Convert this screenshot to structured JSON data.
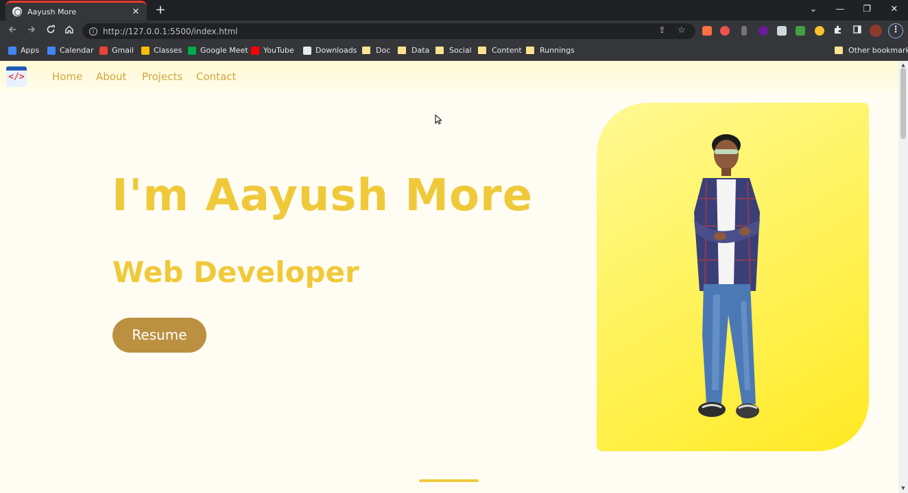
{
  "browser": {
    "tab": {
      "title": "Aayush More",
      "close_label": "✕"
    },
    "new_tab_label": "+",
    "window_controls": {
      "chevron": "⌄",
      "minimize": "—",
      "restore": "❐",
      "close": "✕"
    },
    "url": "http://127.0.0.1:5500/index.html",
    "bookmarks": [
      {
        "label": "Apps",
        "icon": "apps-grid-icon",
        "color": "#4285f4"
      },
      {
        "label": "Calendar",
        "icon": "calendar-icon",
        "color": "#4285f4"
      },
      {
        "label": "Gmail",
        "icon": "gmail-icon",
        "color": "#ea4335"
      },
      {
        "label": "Classes",
        "icon": "classroom-icon",
        "color": "#fbbc04"
      },
      {
        "label": "Google Meet",
        "icon": "meet-icon",
        "color": "#00ac47"
      },
      {
        "label": "YouTube",
        "icon": "youtube-icon",
        "color": "#ff0000"
      },
      {
        "label": "Downloads",
        "icon": "download-icon",
        "color": "#e8eaed"
      },
      {
        "label": "Doc",
        "icon": "folder-icon",
        "color": "#fde293"
      },
      {
        "label": "Data",
        "icon": "folder-icon",
        "color": "#fde293"
      },
      {
        "label": "Social",
        "icon": "folder-icon",
        "color": "#fde293"
      },
      {
        "label": "Content",
        "icon": "folder-icon",
        "color": "#fde293"
      },
      {
        "label": "Runnings",
        "icon": "folder-icon",
        "color": "#fde293"
      }
    ],
    "other_bookmarks": "Other bookmarks"
  },
  "site": {
    "logo_code": "</>",
    "nav": [
      "Home",
      "About",
      "Projects",
      "Contact"
    ],
    "hero": {
      "title": "I'm Aayush More",
      "subtitle": "Web Developer",
      "button": "Resume"
    },
    "colors": {
      "accent": "#f0c93b",
      "nav_text": "#d4a53a",
      "button_bg": "#bb9040",
      "page_bg": "#fffdf3",
      "card_gradient_start": "#fff893",
      "card_gradient_end": "#ffe923"
    }
  }
}
